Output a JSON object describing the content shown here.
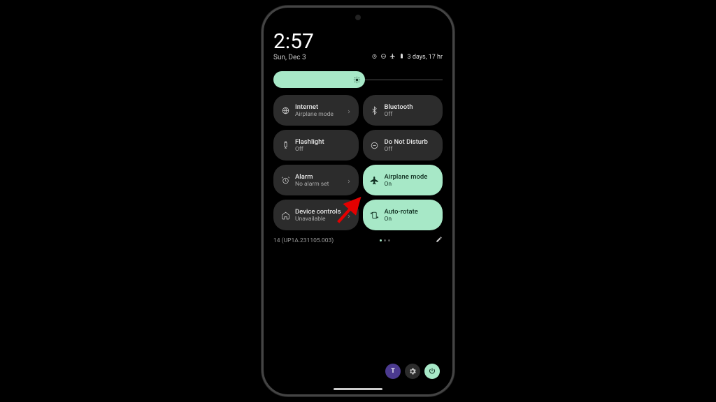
{
  "status": {
    "time": "2:57",
    "date": "Sun, Dec 3",
    "battery_text": "3 days, 17 hr"
  },
  "brightness": {
    "percent": 54
  },
  "tiles": [
    {
      "id": "internet",
      "title": "Internet",
      "sub": "Airplane mode",
      "on": false,
      "chevron": true,
      "icon": "globe"
    },
    {
      "id": "bluetooth",
      "title": "Bluetooth",
      "sub": "Off",
      "on": false,
      "chevron": false,
      "icon": "bt"
    },
    {
      "id": "flash",
      "title": "Flashlight",
      "sub": "Off",
      "on": false,
      "chevron": false,
      "icon": "flash"
    },
    {
      "id": "dnd",
      "title": "Do Not Disturb",
      "sub": "Off",
      "on": false,
      "chevron": false,
      "icon": "dnd"
    },
    {
      "id": "alarm",
      "title": "Alarm",
      "sub": "No alarm set",
      "on": false,
      "chevron": true,
      "icon": "alarm"
    },
    {
      "id": "airplane",
      "title": "Airplane mode",
      "sub": "On",
      "on": true,
      "chevron": false,
      "icon": "plane"
    },
    {
      "id": "device",
      "title": "Device controls",
      "sub": "Unavailable",
      "on": false,
      "chevron": true,
      "icon": "home"
    },
    {
      "id": "rotate",
      "title": "Auto-rotate",
      "sub": "On",
      "on": true,
      "chevron": false,
      "icon": "rotate"
    }
  ],
  "build": "14 (UP1A.231105.003)",
  "pager": {
    "total": 3,
    "active": 0
  },
  "user_initial": "T"
}
